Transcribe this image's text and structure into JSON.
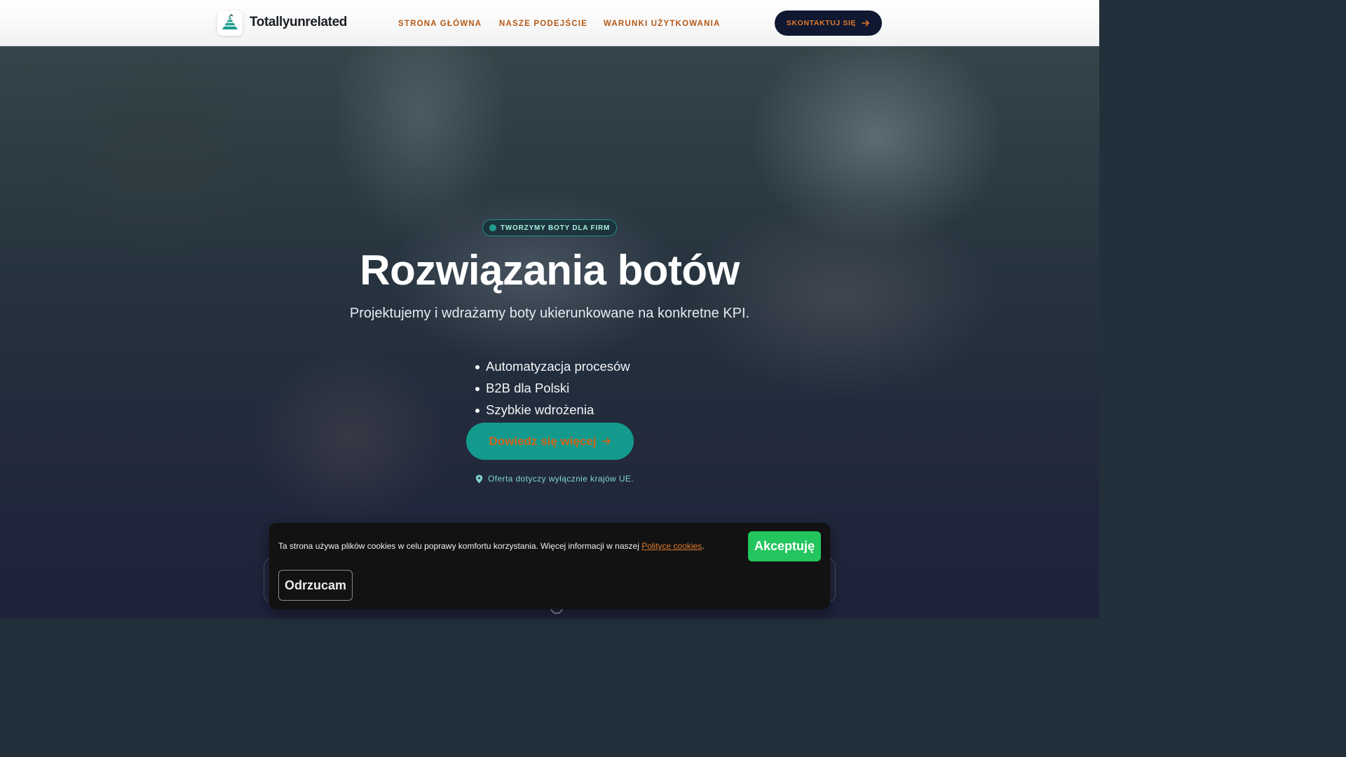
{
  "header": {
    "logo_text": "Totallyunrelated",
    "nav": [
      {
        "label": "STRONA GŁÓWNA"
      },
      {
        "label": "NASZE PODEJŚCIE"
      },
      {
        "label": "WARUNKI UŻYTKOWANIA"
      }
    ],
    "cta_label": "SKONTAKTUJ SIĘ",
    "cta_icon": "arrow-right-icon"
  },
  "hero": {
    "badge": "TWORZYMY BOTY DLA FIRM",
    "title": "Rozwiązania botów",
    "subtitle": "Projektujemy i wdrażamy boty ukierunkowane na konkretne KPI.",
    "features": [
      "Automatyzacja procesów",
      "B2B dla Polski",
      "Szybkie wdrożenia"
    ],
    "cta_label": "Dowiedz się więcej",
    "note": "Oferta dotyczy wyłącznie krajów UE.",
    "note_icon": "map-pin-icon"
  },
  "cookie": {
    "text_before": "Ta strona używa plików cookies w celu poprawy komfortu korzystania. Więcej informacji w naszej ",
    "link_label": "Polityce cookies",
    "text_after": ".",
    "accept_label": "Akceptuję",
    "reject_label": "Odrzucam"
  },
  "colors": {
    "accent_orange": "#d2641b",
    "teal": "#149a8d",
    "navy": "#0f1830",
    "accept_green": "#22c55e"
  }
}
